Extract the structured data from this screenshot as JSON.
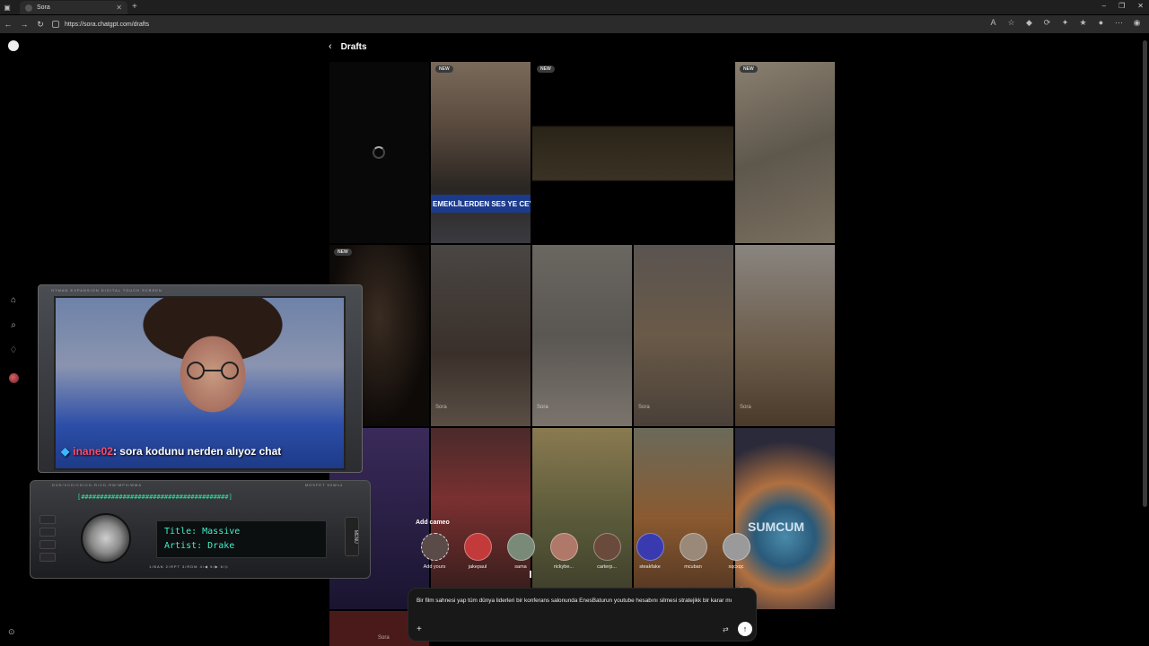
{
  "browser": {
    "tab_title": "Sora",
    "url": "https://sora.chatgpt.com/drafts"
  },
  "page": {
    "header_title": "Drafts",
    "badge_new": "NEW",
    "watermark": "Sora",
    "news_ticker": "EMEKLİLERDEN SES YE CEYL",
    "bubble_text": "SUMCUM"
  },
  "cameos": {
    "label": "Add cameo",
    "items": [
      {
        "name": "Add yours",
        "color": "#5a4a48"
      },
      {
        "name": "jakepaul",
        "color": "#c23a3a"
      },
      {
        "name": "sama",
        "color": "#7a8a78"
      },
      {
        "name": "rickybe...",
        "color": "#b07868"
      },
      {
        "name": "carterp...",
        "color": "#6a4a3a"
      },
      {
        "name": "steakfake",
        "color": "#3a3ab0"
      },
      {
        "name": "mcuban",
        "color": "#9a8878"
      },
      {
        "name": "xqcxqc",
        "color": "#9a9a9a"
      }
    ]
  },
  "composer": {
    "prompt_text": "Bir film sahnesi yap tüm dünya liderleri bir konferans salonunda EnesBaturun youtube hesabını silmesi stratejikk bir karar mı"
  },
  "stream_overlay": {
    "screen_label": "OTMAN EXPANSION DIGITAL TOUCH SCREEN",
    "chat_user": "inane02",
    "chat_message": ": sora kodunu nerden alıyoz chat",
    "stereo_label_left": "DVD/VCD/CD/CD-R/CD-RW/MP3/WMA",
    "stereo_label_right": "MOSFET 50Wx4",
    "eq_bar": "[#######################################]",
    "lcd_title": "Title: Massive",
    "lcd_artist": "Artist: Drake",
    "menu_label": "MENU",
    "bottom_strip": "1/BAN  2/RPT  3/RDM  4/◀  5/▶  6/▷"
  }
}
